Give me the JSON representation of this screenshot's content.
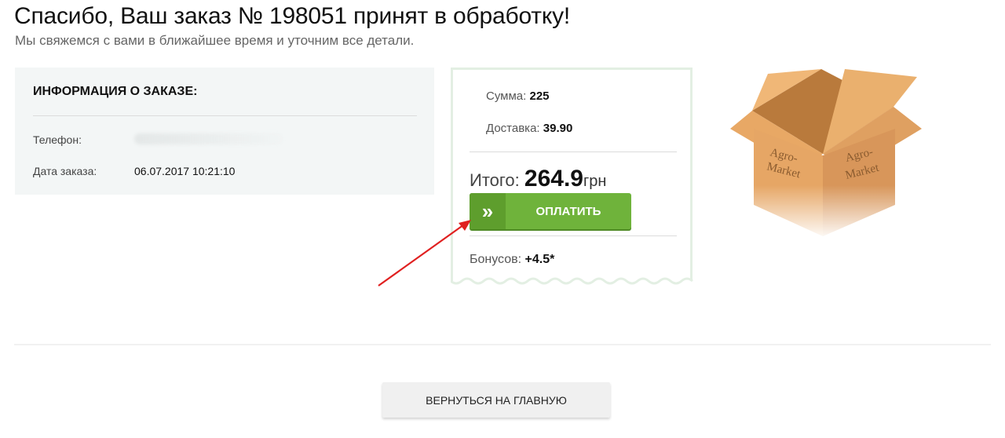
{
  "header": {
    "title": "Спасибо, Ваш заказ № 198051 принят в обработку!",
    "subtitle": "Мы свяжемся с вами в ближайшее время и уточним все детали."
  },
  "order_info": {
    "heading": "ИНФОРМАЦИЯ О ЗАКАЗЕ:",
    "phone_label": "Телефон:",
    "date_label": "Дата заказа:",
    "date_value": "06.07.2017 10:21:10"
  },
  "summary": {
    "sum_label": "Сумма:",
    "sum_value": "225",
    "delivery_label": "Доставка:",
    "delivery_value": "39.90",
    "total_label": "Итого:",
    "total_value": "264.9",
    "currency": "грн",
    "pay_button_label": "ОПЛАТИТЬ",
    "bonus_label": "Бонусов:",
    "bonus_value": "+4.5*"
  },
  "box_image": {
    "icon": "cardboard-box-icon",
    "label_left": "Agro-Market",
    "label_right": "Agro-Market"
  },
  "footer": {
    "home_button_label": "ВЕРНУТЬСЯ НА ГЛАВНУЮ"
  },
  "colors": {
    "accent_green": "#6fb33b",
    "arrow_red": "#e02020",
    "box": "#e3a462"
  }
}
